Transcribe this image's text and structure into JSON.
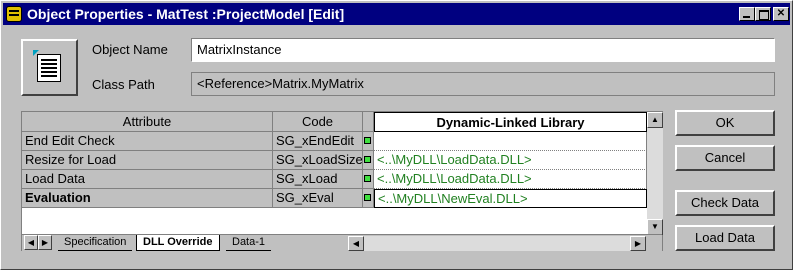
{
  "window": {
    "title": "Object Properties - MatTest :ProjectModel [Edit]",
    "icon": "app-icon"
  },
  "form": {
    "object_name_label": "Object Name",
    "object_name_value": "MatrixInstance",
    "class_path_label": "Class Path",
    "class_path_value": "<Reference>Matrix.MyMatrix"
  },
  "grid": {
    "headers": {
      "attribute": "Attribute",
      "code": "Code",
      "dll": "Dynamic-Linked Library"
    },
    "rows": [
      {
        "attribute": "End Edit Check",
        "code": "SG_xEndEdit",
        "dll": ""
      },
      {
        "attribute": "Resize for Load",
        "code": "SG_xLoadSize",
        "dll": "<..\\MyDLL\\LoadData.DLL>"
      },
      {
        "attribute": "Load Data",
        "code": "SG_xLoad",
        "dll": "<..\\MyDLL\\LoadData.DLL>"
      },
      {
        "attribute": "Evaluation",
        "code": "SG_xEval",
        "dll": "<..\\MyDLL\\NewEval.DLL>"
      }
    ],
    "tabs": [
      "Specification",
      "DLL Override",
      "Data-1"
    ],
    "active_tab": "DLL Override"
  },
  "buttons": {
    "ok": "OK",
    "cancel": "Cancel",
    "check_data": "Check Data",
    "load_data": "Load Data"
  },
  "colors": {
    "titlebar": "#000080",
    "dll_text": "#208020",
    "led": "#40e040"
  }
}
